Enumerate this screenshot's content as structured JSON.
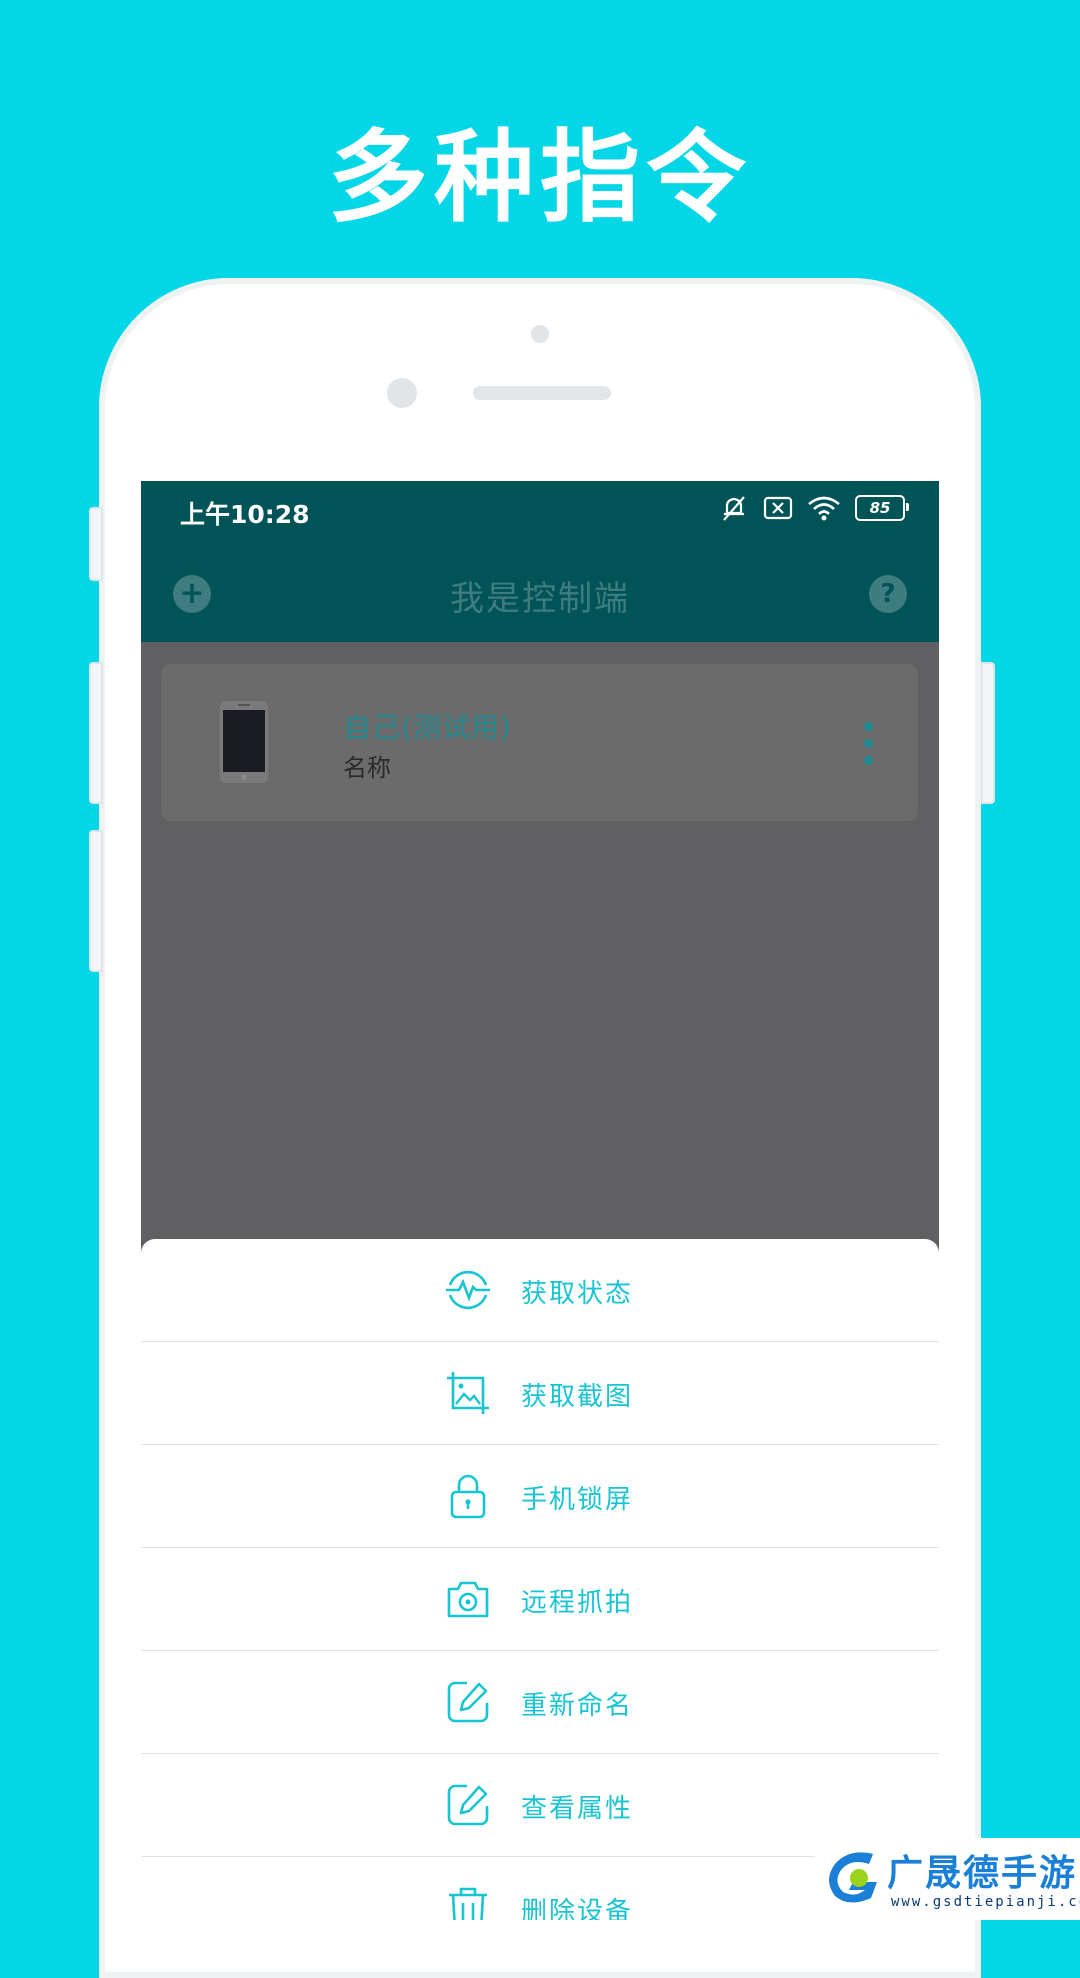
{
  "headline": "多种指令",
  "status_bar": {
    "time": "上午10:28",
    "battery": "85"
  },
  "app_bar": {
    "title": "我是控制端"
  },
  "device": {
    "name": "自己(测试用)",
    "subtitle": "名称"
  },
  "menu": [
    {
      "label": "获取状态",
      "icon": "pulse-icon"
    },
    {
      "label": "获取截图",
      "icon": "screenshot-icon"
    },
    {
      "label": "手机锁屏",
      "icon": "lock-icon"
    },
    {
      "label": "远程抓拍",
      "icon": "camera-icon"
    },
    {
      "label": "重新命名",
      "icon": "edit-icon"
    },
    {
      "label": "查看属性",
      "icon": "edit-icon"
    },
    {
      "label": "删除设备",
      "icon": "trash-icon"
    }
  ],
  "watermark": {
    "brand": "广晟德手游",
    "url": "www.gsdtiepianji.com"
  },
  "colors": {
    "background": "#03d6e6",
    "appbar": "#005458",
    "accent": "#18c4d2",
    "overlay": "#606063"
  }
}
